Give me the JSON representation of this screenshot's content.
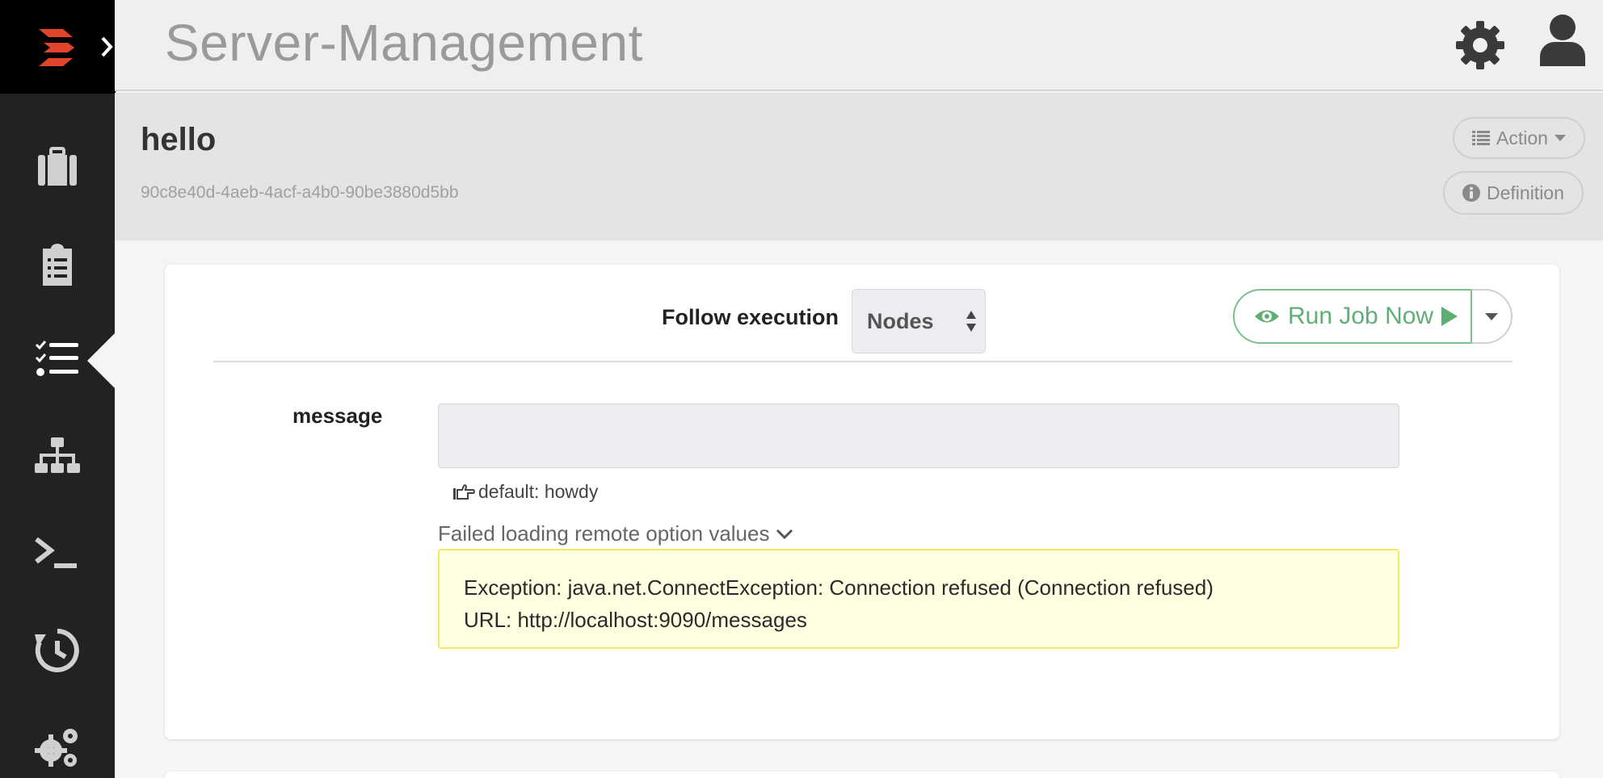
{
  "header": {
    "project_title": "Server-Management"
  },
  "job": {
    "name": "hello",
    "uuid": "90c8e40d-4aeb-4acf-a4b0-90be3880d5bb",
    "action_label": "Action",
    "definition_label": "Definition"
  },
  "execution": {
    "follow_label": "Follow execution",
    "follow_mode": "Nodes",
    "run_label": "Run Job Now"
  },
  "option": {
    "label": "message",
    "value": "",
    "default_text": "default: howdy",
    "remote_error_toggle": "Failed loading remote option values",
    "error_line1": "Exception: java.net.ConnectException: Connection refused (Connection refused)",
    "error_line2": "URL: http://localhost:9090/messages"
  },
  "sidebar": {
    "items": [
      {
        "icon": "briefcase-icon"
      },
      {
        "icon": "clipboard-icon"
      },
      {
        "icon": "task-list-icon",
        "active": true
      },
      {
        "icon": "sitemap-icon"
      },
      {
        "icon": "terminal-icon"
      },
      {
        "icon": "history-icon"
      },
      {
        "icon": "gears-icon"
      }
    ]
  },
  "colors": {
    "sidebar_bg": "#222222",
    "logo_red": "#e0442a",
    "run_green": "#5fae75",
    "error_bg": "#ffffe2",
    "error_border": "#f0ea60"
  }
}
